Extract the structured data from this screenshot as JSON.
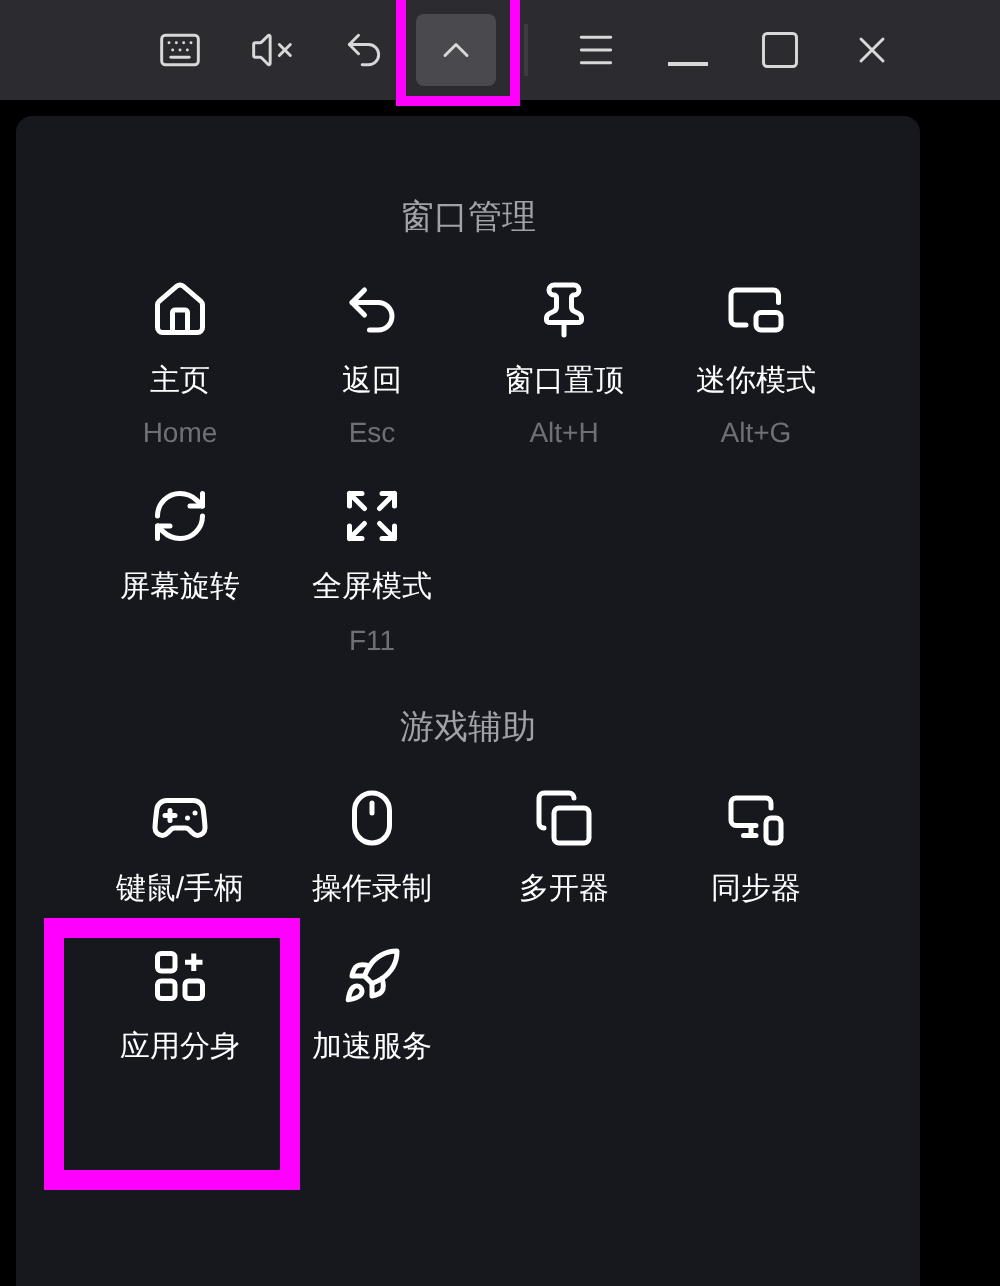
{
  "toolbar": [
    {
      "kind": "keyboard",
      "highlighted": false
    },
    {
      "kind": "mute",
      "highlighted": false
    },
    {
      "kind": "back",
      "highlighted": false
    },
    {
      "kind": "collapse",
      "highlighted": true
    },
    {
      "kind": "menu",
      "highlighted": false
    },
    {
      "kind": "minimize",
      "highlighted": false
    },
    {
      "kind": "maximize",
      "highlighted": false
    },
    {
      "kind": "close",
      "highlighted": false
    }
  ],
  "sections": [
    {
      "title": "窗口管理",
      "items": [
        {
          "kind": "home",
          "label": "主页",
          "shortcut": "Home",
          "highlighted": false
        },
        {
          "kind": "back",
          "label": "返回",
          "shortcut": "Esc",
          "highlighted": false
        },
        {
          "kind": "pin",
          "label": "窗口置顶",
          "shortcut": "Alt+H",
          "highlighted": false
        },
        {
          "kind": "mini",
          "label": "迷你模式",
          "shortcut": "Alt+G",
          "highlighted": false
        },
        {
          "kind": "rotate",
          "label": "屏幕旋转",
          "highlighted": false
        },
        {
          "kind": "fullscreen",
          "label": "全屏模式",
          "shortcut": "F11",
          "highlighted": false
        }
      ]
    },
    {
      "title": "游戏辅助",
      "items": [
        {
          "kind": "gamepad",
          "label": "键鼠/手柄",
          "highlighted": false
        },
        {
          "kind": "record",
          "label": "操作录制",
          "highlighted": false
        },
        {
          "kind": "multi",
          "label": "多开器",
          "highlighted": false
        },
        {
          "kind": "sync",
          "label": "同步器",
          "highlighted": false
        },
        {
          "kind": "apps",
          "label": "应用分身",
          "highlighted": true
        },
        {
          "kind": "rocket",
          "label": "加速服务",
          "highlighted": false
        }
      ]
    }
  ]
}
